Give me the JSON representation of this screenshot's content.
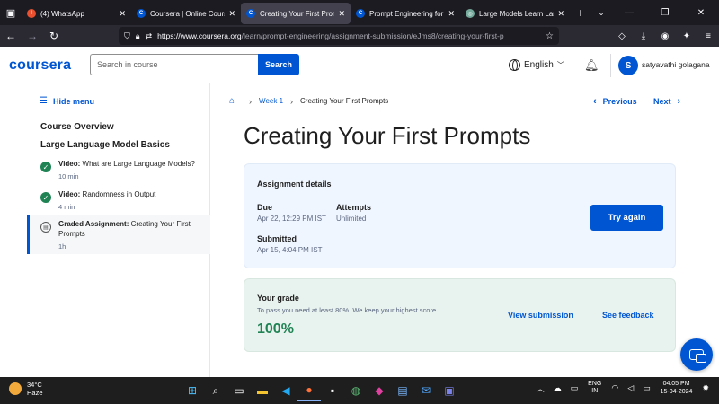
{
  "browser": {
    "tabs": [
      {
        "title": "(4) WhatsApp",
        "fav_color": "#e8502f",
        "fav_glyph": "!",
        "active": false
      },
      {
        "title": "Coursera | Online Courses",
        "fav_color": "#0056d2",
        "fav_glyph": "C",
        "active": false
      },
      {
        "title": "Creating Your First Prompts",
        "fav_color": "#0056d2",
        "fav_glyph": "C",
        "active": true
      },
      {
        "title": "Prompt Engineering for C",
        "fav_color": "#0056d2",
        "fav_glyph": "C",
        "active": false
      },
      {
        "title": "Large Models Learn Langu",
        "fav_color": "#74aa9c",
        "fav_glyph": "◎",
        "active": false
      }
    ],
    "url_host": "https://www.coursera.org",
    "url_path": "/learn/prompt-engineering/assignment-submission/eJms8/creating-your-first-p"
  },
  "header": {
    "logo": "coursera",
    "search_placeholder": "Search in course",
    "search_button": "Search",
    "language": "English",
    "avatar_initial": "S",
    "user_name": "satyavathi golagana"
  },
  "sidebar": {
    "hide_menu": "Hide menu",
    "course_overview": "Course Overview",
    "module_title": "Large Language Model Basics",
    "items": [
      {
        "kind": "Video:",
        "title": "What are Large Language Models?",
        "meta": "10 min",
        "done": true
      },
      {
        "kind": "Video:",
        "title": "Randomness in Output",
        "meta": "4 min",
        "done": true
      },
      {
        "kind": "Graded Assignment:",
        "title": "Creating Your First Prompts",
        "meta": "1h",
        "done": false
      }
    ]
  },
  "breadcrumb": {
    "week": "Week 1",
    "current": "Creating Your First Prompts"
  },
  "pager": {
    "previous": "Previous",
    "next": "Next"
  },
  "page_title": "Creating Your First Prompts",
  "assignment": {
    "heading": "Assignment details",
    "due_label": "Due",
    "due_value": "Apr 22, 12:29 PM IST",
    "attempts_label": "Attempts",
    "attempts_value": "Unlimited",
    "submitted_label": "Submitted",
    "submitted_value": "Apr 15, 4:04 PM IST",
    "try_again": "Try again"
  },
  "grade": {
    "heading": "Your grade",
    "hint": "To pass you need at least 80%. We keep your highest score.",
    "value": "100%",
    "view_submission": "View submission",
    "see_feedback": "See feedback"
  },
  "taskbar": {
    "temperature": "34°C",
    "condition": "Haze",
    "lang_top": "ENG",
    "lang_bottom": "IN",
    "time": "04:05 PM",
    "date": "15-04-2024"
  }
}
